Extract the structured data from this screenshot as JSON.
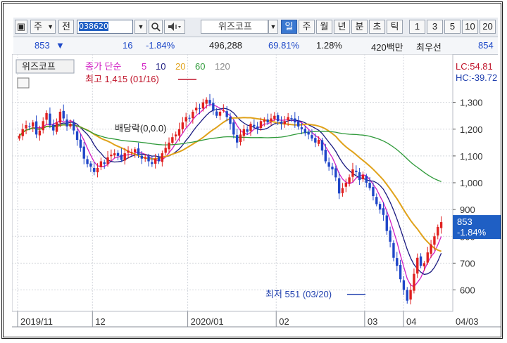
{
  "toolbar": {
    "mode1": "주",
    "mode2": "전",
    "code": "038620",
    "market_badge": "주",
    "stock_name": "위즈코프",
    "periods": [
      "일",
      "주",
      "월",
      "년",
      "분",
      "초",
      "틱"
    ],
    "active_period": "일",
    "intervals": [
      "1",
      "3",
      "5",
      "10",
      "20"
    ]
  },
  "info": {
    "price": "853",
    "change": "16",
    "change_pct": "-1.84%",
    "volume": "496,288",
    "ratio": "69.81%",
    "turnover": "1.28%",
    "amount": "420백만",
    "best_ask_label": "최우선",
    "best_ask": "854"
  },
  "legend": {
    "stock": "위즈코프",
    "ma_label": "종가 단순",
    "periods": [
      {
        "label": "5",
        "color": "#d11fc4"
      },
      {
        "label": "10",
        "color": "#1a1a80"
      },
      {
        "label": "20",
        "color": "#e0a21a"
      },
      {
        "label": "60",
        "color": "#2f9a3a"
      },
      {
        "label": "120",
        "color": "#8a8a8a"
      }
    ]
  },
  "annotations": {
    "high": "최고 1,415 (01/16)",
    "low": "최저 551 (03/20)",
    "dividend": "배당락(0,0.0)"
  },
  "right_labels": {
    "lc": "LC:54.81",
    "hc": "HC:-39.72",
    "current_price": "853",
    "current_pct": "-1.84%"
  },
  "colors": {
    "up": "#e0201f",
    "down": "#1f46c8",
    "accent": "#1f5fc4"
  },
  "chart_data": {
    "type": "candlestick",
    "ylim": [
      520,
      1480
    ],
    "yticks": [
      600,
      700,
      800,
      900,
      1000,
      1100,
      1200,
      1300
    ],
    "ytick_labels": [
      "600",
      "700",
      "800",
      "900",
      "1,000",
      "1,100",
      "1,200",
      "1,300"
    ],
    "xtick_labels": [
      "2019/11",
      "12",
      "2020/01",
      "02",
      "03",
      "04",
      "04/03"
    ],
    "close": [
      1175,
      1200,
      1215,
      1210,
      1225,
      1180,
      1195,
      1230,
      1260,
      1215,
      1195,
      1225,
      1265,
      1240,
      1210,
      1220,
      1195,
      1160,
      1130,
      1090,
      1070,
      1060,
      1040,
      1055,
      1080,
      1070,
      1095,
      1105,
      1110,
      1100,
      1085,
      1110,
      1120,
      1115,
      1125,
      1105,
      1090,
      1095,
      1080,
      1070,
      1090,
      1080,
      1110,
      1130,
      1150,
      1170,
      1180,
      1200,
      1225,
      1245,
      1240,
      1265,
      1280,
      1275,
      1300,
      1310,
      1295,
      1270,
      1250,
      1265,
      1270,
      1245,
      1220,
      1180,
      1150,
      1180,
      1200,
      1190,
      1220,
      1210,
      1200,
      1230,
      1235,
      1225,
      1240,
      1250,
      1230,
      1220,
      1230,
      1245,
      1240,
      1225,
      1210,
      1200,
      1185,
      1180,
      1165,
      1150,
      1160,
      1120,
      1080,
      1060,
      1050,
      1020,
      960,
      980,
      1000,
      1020,
      1050,
      1040,
      1010,
      1030,
      1000,
      980,
      950,
      920,
      900,
      880,
      820,
      780,
      720,
      690,
      640,
      600,
      560,
      600,
      660,
      720,
      690,
      700,
      740,
      770,
      800,
      835,
      853
    ]
  }
}
